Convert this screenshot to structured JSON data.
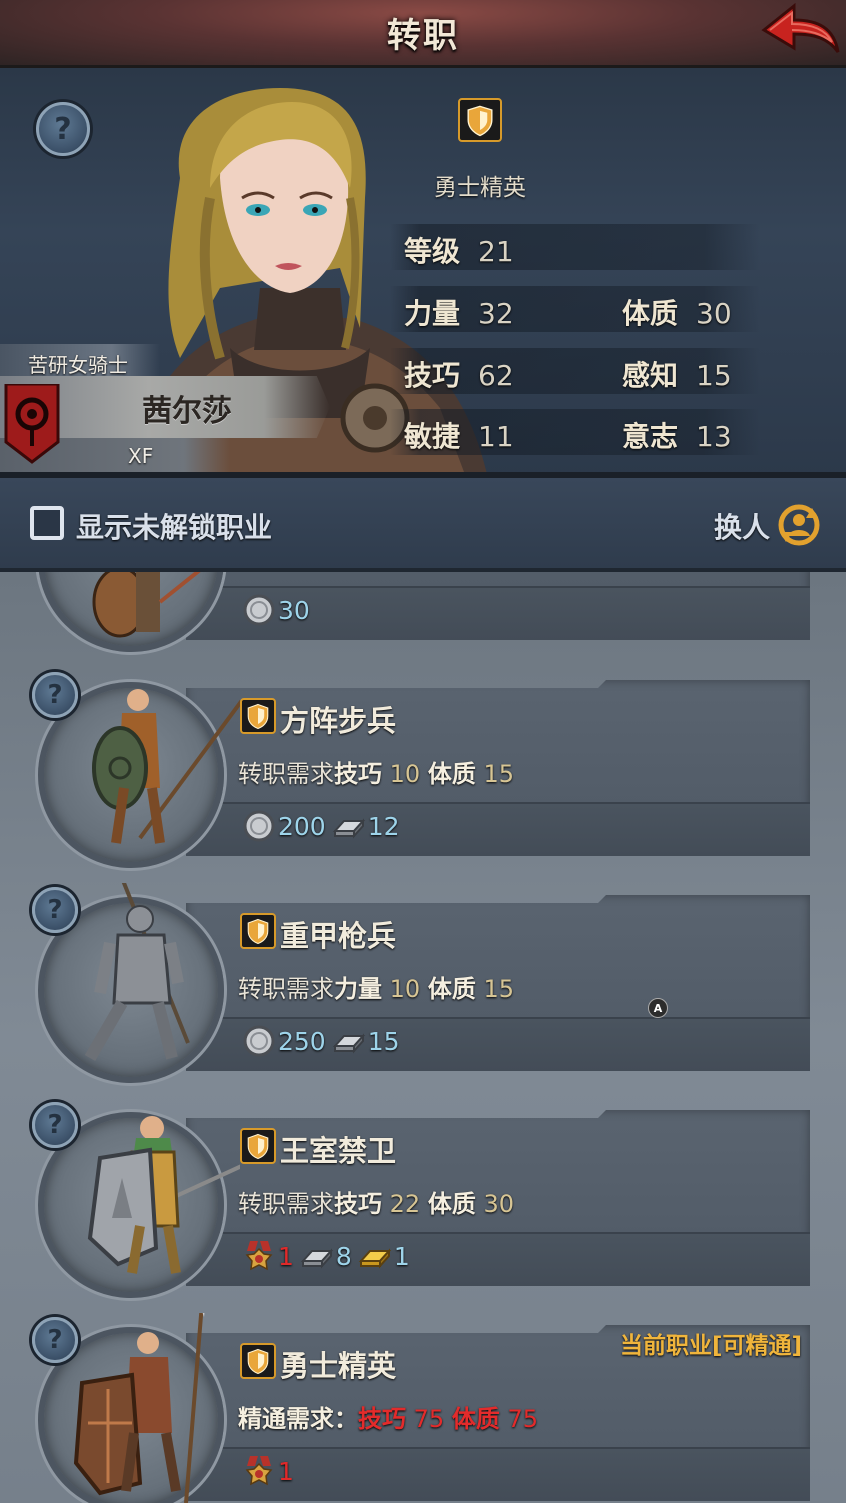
{
  "header": {
    "title": "转职"
  },
  "hero": {
    "class_name": "勇士精英",
    "title": "苦研女骑士",
    "name": "茜尔莎",
    "tag": "XF",
    "stats": {
      "level": {
        "label": "等级",
        "value": "21"
      },
      "strength": {
        "label": "力量",
        "value": "32"
      },
      "constitution": {
        "label": "体质",
        "value": "30"
      },
      "skill": {
        "label": "技巧",
        "value": "62"
      },
      "perception": {
        "label": "感知",
        "value": "15"
      },
      "agility": {
        "label": "敏捷",
        "value": "11"
      },
      "will": {
        "label": "意志",
        "value": "13"
      }
    }
  },
  "filter": {
    "show_locked_label": "显示未解锁职业",
    "swap_label": "换人"
  },
  "classes": [
    {
      "cost_silver": "30"
    },
    {
      "name": "方阵步兵",
      "req_prefix": "转职需求",
      "req1_label": "技巧",
      "req1_value": "10",
      "req2_label": "体质",
      "req2_value": "15",
      "cost_silver": "200",
      "cost_iron": "12"
    },
    {
      "name": "重甲枪兵",
      "req_prefix": "转职需求",
      "req1_label": "力量",
      "req1_value": "10",
      "req2_label": "体质",
      "req2_value": "15",
      "cost_silver": "250",
      "cost_iron": "15"
    },
    {
      "name": "王室禁卫",
      "req_prefix": "转职需求",
      "req1_label": "技巧",
      "req1_value": "22",
      "req2_label": "体质",
      "req2_value": "30",
      "cost_medal": "1",
      "cost_iron": "8",
      "cost_gold": "1"
    },
    {
      "name": "勇士精英",
      "req_prefix": "精通需求：",
      "req1_label": "技巧",
      "req1_value": "75",
      "req2_label": "体质",
      "req2_value": "75",
      "cost_medal": "1",
      "status": "当前职业[可精通]"
    }
  ],
  "overlay_badge": "A",
  "colors": {
    "accent_gold": "#f0b53c",
    "requirement_red": "#e32b2b",
    "cost_blue": "#9ed4ea",
    "class_icon_border": "#d79a2a"
  },
  "icons": [
    "back-arrow-icon",
    "help-icon",
    "shield-class-icon",
    "silver-coin-icon",
    "iron-ingot-icon",
    "gold-ingot-icon",
    "medal-icon",
    "swap-person-icon",
    "faction-banner-icon"
  ]
}
